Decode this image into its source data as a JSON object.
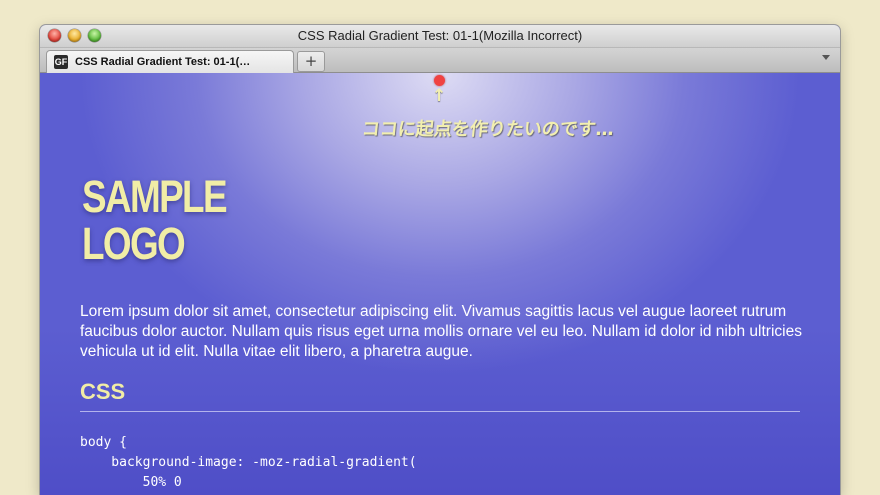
{
  "window": {
    "title": "CSS Radial Gradient Test: 01-1(Mozilla Incorrect)"
  },
  "tabs": [
    {
      "label": "CSS Radial Gradient Test: 01-1(…",
      "favicon": "GF"
    }
  ],
  "new_tab_label": "+",
  "annotation": {
    "arrow": "↑",
    "text": "ココに起点を作りたいのです…"
  },
  "logo": {
    "line1": "SAMPLE",
    "line2": "LOGO"
  },
  "body_text": "Lorem ipsum dolor sit amet, consectetur adipiscing elit. Vivamus sagittis lacus vel augue laoreet rutrum faucibus dolor auctor. Nullam quis risus eget urna mollis ornare vel eu leo. Nullam id dolor id nibh ultricies vehicula ut id elit. Nulla vitae elit libero, a pharetra augue.",
  "section_heading": "CSS",
  "code_lines": [
    "body {",
    "    background-image: -moz-radial-gradient(",
    "        50% 0"
  ],
  "colors": {
    "logo": "#f1eda6",
    "marker": "#f04242",
    "page_background": "#efe9c9"
  }
}
